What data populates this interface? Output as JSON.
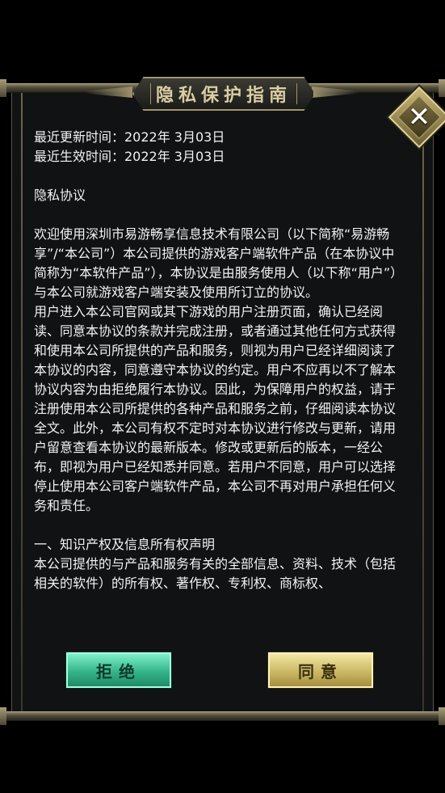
{
  "dialog": {
    "title": "隐私保护指南",
    "close_icon": "close-icon"
  },
  "agreement": {
    "updated": "最近更新时间：2022年 3月03日",
    "effective": "最近生效时间：2022年 3月03日",
    "heading": "隐私协议",
    "para1": "欢迎使用深圳市易游畅享信息技术有限公司（以下简称“易游畅享”/“本公司”）本公司提供的游戏客户端软件产品（在本协议中简称为“本软件产品”），本协议是由服务使用人（以下称“用户”）与本公司就游戏客户端安装及使用所订立的协议。",
    "para2": "用户进入本公司官网或其下游戏的用户注册页面，确认已经阅读、同意本协议的条款并完成注册，或者通过其他任何方式获得和使用本公司所提供的产品和服务，则视为用户已经详细阅读了本协议的内容，同意遵守本协议的约定。用户不应再以不了解本协议内容为由拒绝履行本协议。因此，为保障用户的权益，请于注册使用本公司所提供的各种产品和服务之前，仔细阅读本协议全文。此外，本公司有权不定时对本协议进行修改与更新，请用户留意查看本协议的最新版本。修改或更新后的版本，一经公布，即视为用户已经知悉并同意。若用户不同意，用户可以选择停止使用本公司客户端软件产品，本公司不再对用户承担任何义务和责任。",
    "section1_title": "一、知识产权及信息所有权声明",
    "section1_text": "本公司提供的与产品和服务有关的全部信息、资料、技术（包括相关的软件）的所有权、著作权、专利权、商标权、"
  },
  "buttons": {
    "refuse": "拒绝",
    "agree": "同意"
  }
}
